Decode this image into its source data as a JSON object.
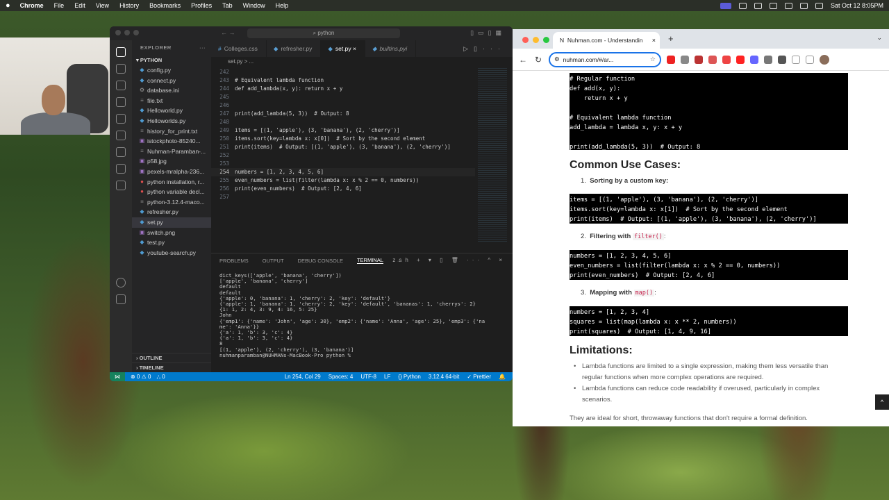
{
  "menubar": {
    "apple": "",
    "app": "Chrome",
    "items": [
      "File",
      "Edit",
      "View",
      "History",
      "Bookmarks",
      "Profiles",
      "Tab",
      "Window",
      "Help"
    ],
    "datetime": "Sat Oct 12  8:05PM"
  },
  "vscode": {
    "search": "python",
    "tabs": [
      {
        "label": "Colleges.css",
        "icon": "#"
      },
      {
        "label": "refresher.py",
        "icon": "py"
      },
      {
        "label": "set.py",
        "icon": "py",
        "active": true
      },
      {
        "label": "builtins.pyi",
        "icon": "py",
        "italic": true
      }
    ],
    "breadcrumb": "set.py  >  ...",
    "explorer_title": "EXPLORER",
    "folder": "PYTHON",
    "files": [
      {
        "name": "config.py",
        "type": "py"
      },
      {
        "name": "connect.py",
        "type": "py"
      },
      {
        "name": "database.ini",
        "type": "ini"
      },
      {
        "name": "file.txt",
        "type": "txt"
      },
      {
        "name": "Helloworld.py",
        "type": "py"
      },
      {
        "name": "Helloworlds.py",
        "type": "py"
      },
      {
        "name": "history_for_print.txt",
        "type": "txt"
      },
      {
        "name": "istockphoto-85240...",
        "type": "img"
      },
      {
        "name": "Nuhman-Paramban-...",
        "type": "txt"
      },
      {
        "name": "p58.jpg",
        "type": "img"
      },
      {
        "name": "pexels-mralpha-236...",
        "type": "img"
      },
      {
        "name": "python installation, r...",
        "type": "chrome"
      },
      {
        "name": "python variable decl...",
        "type": "chrome"
      },
      {
        "name": "python-3.12.4-maco...",
        "type": "txt"
      },
      {
        "name": "refresher.py",
        "type": "py"
      },
      {
        "name": "set.py",
        "type": "py",
        "selected": true
      },
      {
        "name": "switch.png",
        "type": "img"
      },
      {
        "name": "test.py",
        "type": "py"
      },
      {
        "name": "youtube-search.py",
        "type": "py"
      }
    ],
    "outline": "OUTLINE",
    "timeline": "TIMELINE",
    "code": [
      {
        "ln": "242",
        "t": ""
      },
      {
        "ln": "243",
        "t": "# Equivalent lambda function",
        "cls": "c"
      },
      {
        "ln": "244",
        "t": "def add_lambda(x, y): return x + y"
      },
      {
        "ln": "245",
        "t": ""
      },
      {
        "ln": "246",
        "t": ""
      },
      {
        "ln": "247",
        "t": "print(add_lambda(5, 3))  # Output: 8"
      },
      {
        "ln": "248",
        "t": ""
      },
      {
        "ln": "249",
        "t": "items = [(1, 'apple'), (3, 'banana'), (2, 'cherry')]"
      },
      {
        "ln": "250",
        "t": "items.sort(key=lambda x: x[0])  # Sort by the second element"
      },
      {
        "ln": "251",
        "t": "print(items)  # Output: [(1, 'apple'), (3, 'banana'), (2, 'cherry')]"
      },
      {
        "ln": "252",
        "t": ""
      },
      {
        "ln": "253",
        "t": ""
      },
      {
        "ln": "254",
        "t": "numbers = [1, 2, 3, 4, 5, 6]",
        "cur": true
      },
      {
        "ln": "255",
        "t": "even_numbers = list(filter(lambda x: x % 2 == 0, numbers))"
      },
      {
        "ln": "256",
        "t": "print(even_numbers)  # Output: [2, 4, 6]"
      },
      {
        "ln": "257",
        "t": ""
      }
    ],
    "panel_tabs": [
      "PROBLEMS",
      "OUTPUT",
      "DEBUG CONSOLE",
      "TERMINAL"
    ],
    "terminal_shell": "zsh",
    "terminal": "dict_keys(['apple', 'banana', 'cherry'])\n['apple', 'banana', 'cherry']\ndefault\ndefault\n{'apple': 0, 'banana': 1, 'cherry': 2, 'key': 'default'}\n{'apple': 1, 'banana': 1, 'cherry': 2, 'key': 'default', 'bananas': 1, 'cherrys': 2}\n{1: 1, 2: 4, 3: 9, 4: 16, 5: 25}\nJohn\n{'emp1': {'name': 'John', 'age': 30}, 'emp2': {'name': 'Anna', 'age': 25}, 'emp3': {'na\nme': 'Anna'}}\n{'a': 1, 'b': 3, 'c': 4}\n{'a': 1, 'b': 3, 'c': 4}\n8\n[(1, 'apple'), (2, 'cherry'), (3, 'banana')]\nnuhmanparamban@NUHMANs-MacBook-Pro python % ",
    "status": {
      "errors": "⊗ 0 ⚠ 0",
      "ports": "⛬ 0",
      "position": "Ln 254, Col 29",
      "spaces": "Spaces: 4",
      "encoding": "UTF-8",
      "eol": "LF",
      "language": "{} Python",
      "interpreter": "3.12.4 64-bit",
      "formatter": "✓ Prettier"
    }
  },
  "chrome": {
    "tab_title": "Nuhman.com - Understandin",
    "url": "nuhman.com/#/ar...",
    "page": {
      "code1": "# Regular function\ndef add(x, y):\n    return x + y\n\n# Equivalent lambda function\nadd_lambda = lambda x, y: x + y\n\nprint(add_lambda(5, 3))  # Output: 8",
      "h_use": "Common Use Cases:",
      "li1_num": "1.",
      "li1_label": "Sorting by a custom key:",
      "code2": "items = [(1, 'apple'), (3, 'banana'), (2, 'cherry')]\nitems.sort(key=lambda x: x[1])  # Sort by the second element\nprint(items)  # Output: [(1, 'apple'), (3, 'banana'), (2, 'cherry')]",
      "li2_num": "2.",
      "li2_label": "Filtering with",
      "li2_code": "filter()",
      "li2_colon": ":",
      "code3": "numbers = [1, 2, 3, 4, 5, 6]\neven_numbers = list(filter(lambda x: x % 2 == 0, numbers))\nprint(even_numbers)  # Output: [2, 4, 6]",
      "li3_num": "3.",
      "li3_label": "Mapping with",
      "li3_code": "map()",
      "li3_colon": ":",
      "code4": "numbers = [1, 2, 3, 4]\nsquares = list(map(lambda x: x ** 2, numbers))\nprint(squares)  # Output: [1, 4, 9, 16]",
      "h_lim": "Limitations:",
      "bullet1": "Lambda functions are limited to a single expression, making them less versatile than regular functions when more complex operations are required.",
      "bullet2": "Lambda functions can reduce code readability if overused, particularly in complex scenarios.",
      "closing": "They are ideal for short, throwaway functions that don't require a formal definition."
    }
  }
}
